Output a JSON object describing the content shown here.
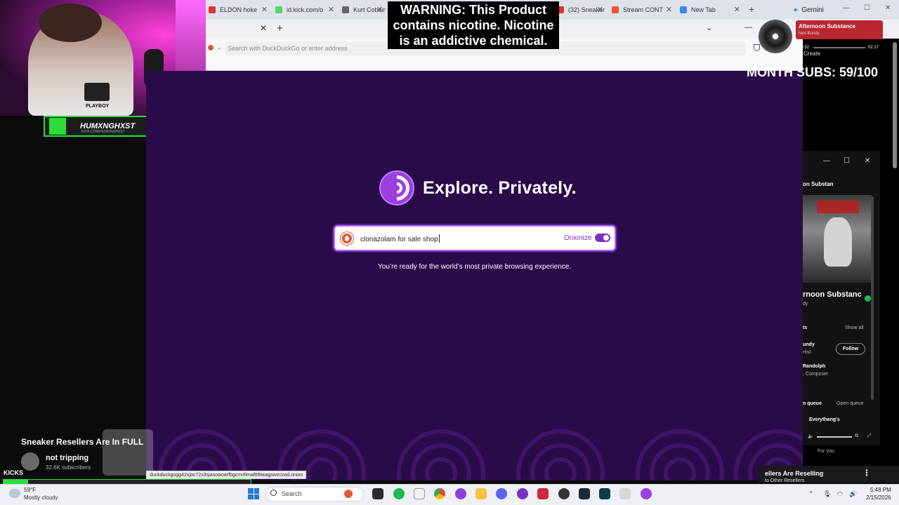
{
  "browser_tabs": [
    {
      "label": "ELDON hoke",
      "color": "#e3342f"
    },
    {
      "label": "id.kick.com/o",
      "color": "#53d769"
    },
    {
      "label": "Kurt Cobain",
      "color": "#666666"
    },
    {
      "label": "(32) Sneaker",
      "color": "#e3342f"
    },
    {
      "label": "Stream CONT",
      "color": "#f0552b"
    },
    {
      "label": "New Tab",
      "color": "#4285f4"
    }
  ],
  "gemini_label": "Gemini",
  "warning_text": "WARNING: This Product contains nicotine. Nicotine is an addictive chemical.",
  "tor": {
    "url_placeholder": "Search with DuckDuckGo or enter address",
    "tagline": "Explore. Privately.",
    "search_value": "clonazolam for sale shop",
    "onionize_label": "Onionize",
    "onionize_on": true,
    "ready_text": "You’re ready for the world’s most private browsing experience.",
    "status_url": "duckduckgogg42xjoc72x3sjasowoarfbgcmvfimaftt6twagswzczad.onion",
    "accent_color": "#7b2fbf",
    "bg_color": "#2a0b4a"
  },
  "stream": {
    "streamer_name": "HUMXNGHXST",
    "streamer_url": "KICK.COM/HUMXNGHXST",
    "shirt_text": "PLAYBOY",
    "video_title": "Sneaker Resellers Are In FULL",
    "channel_name": "not tripping",
    "channel_subs": "32.6K subscribers",
    "kicks_label": "KICKS",
    "month_subs": "MONTH SUBS: 59/100",
    "sub_goal_fraction": 0.1
  },
  "spotify": {
    "mini_title": "Afternoon Substance",
    "mini_artist": "Ned Bundy",
    "time_elapsed": "00:32",
    "time_total": "02:17",
    "create_label": "Create",
    "header": "on Substan",
    "track_title": "rnoon Substanc",
    "track_artist_short": "dy",
    "credits_label": "ts",
    "show_all": "Show all",
    "credit1_name": "undy",
    "credit1_role": "rtist",
    "follow_label": "Follow",
    "credit2_name": "Randolph",
    "credit2_role": ", Composer",
    "queue_label": "n queue",
    "open_queue": "Open queue",
    "next_track": "Everythang's",
    "bottom_title": "ellers Are Reselling",
    "bottom_sub": "to Other Resellers",
    "for_you": "For you"
  },
  "taskbar": {
    "temperature": "59°F",
    "weather": "Mostly cloudy",
    "search_label": "Search",
    "time": "5:48 PM",
    "date": "2/15/2026"
  }
}
